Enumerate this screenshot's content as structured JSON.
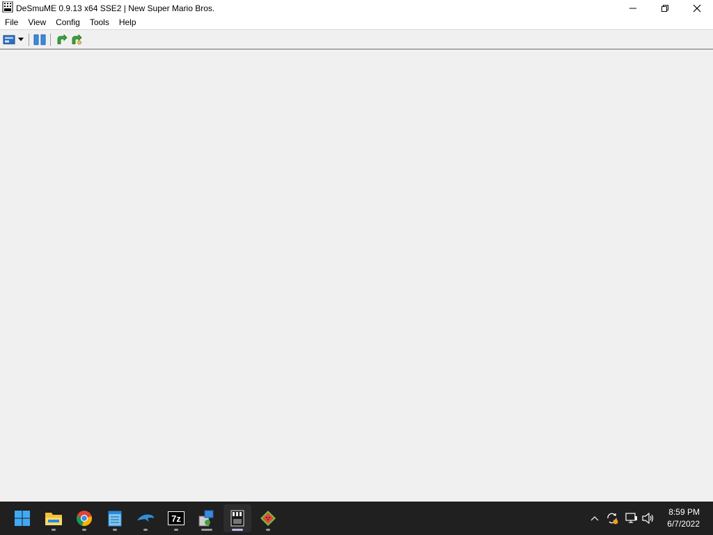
{
  "window": {
    "title": "DeSmuME 0.9.13 x64 SSE2 | New Super Mario Bros.",
    "app_icon": "desmume-icon",
    "controls": [
      "minimize-icon",
      "restore-icon",
      "close-icon"
    ]
  },
  "menu": {
    "items": [
      {
        "label": "File"
      },
      {
        "label": "View"
      },
      {
        "label": "Config"
      },
      {
        "label": "Tools"
      },
      {
        "label": "Help"
      }
    ]
  },
  "toolbar": {
    "buttons": [
      "open-rom-icon",
      "dropdown-arrow-icon",
      "pause-icon",
      "reset-icon",
      "reset-alt-icon"
    ]
  },
  "taskbar": {
    "apps": [
      {
        "name": "windows-start-icon",
        "running": false
      },
      {
        "name": "file-explorer-icon",
        "running": true
      },
      {
        "name": "chrome-icon",
        "running": true
      },
      {
        "name": "notepad-icon",
        "running": true
      },
      {
        "name": "dolphin-icon",
        "running": true
      },
      {
        "name": "7zip-icon",
        "running": true
      },
      {
        "name": "installer-icon",
        "running": true
      },
      {
        "name": "desmume-icon",
        "running": true,
        "active": true
      },
      {
        "name": "melonds-icon",
        "running": true
      }
    ],
    "tray": [
      "chevron-up-icon",
      "sync-icon",
      "network-icon",
      "volume-icon"
    ],
    "clock": {
      "time": "8:59 PM",
      "date": "6/7/2022"
    }
  },
  "colors": {
    "window_bg": "#f0f0f0",
    "titlebar_bg": "#ffffff",
    "taskbar_bg": "#202020",
    "accent_blue": "#2b88d8"
  }
}
